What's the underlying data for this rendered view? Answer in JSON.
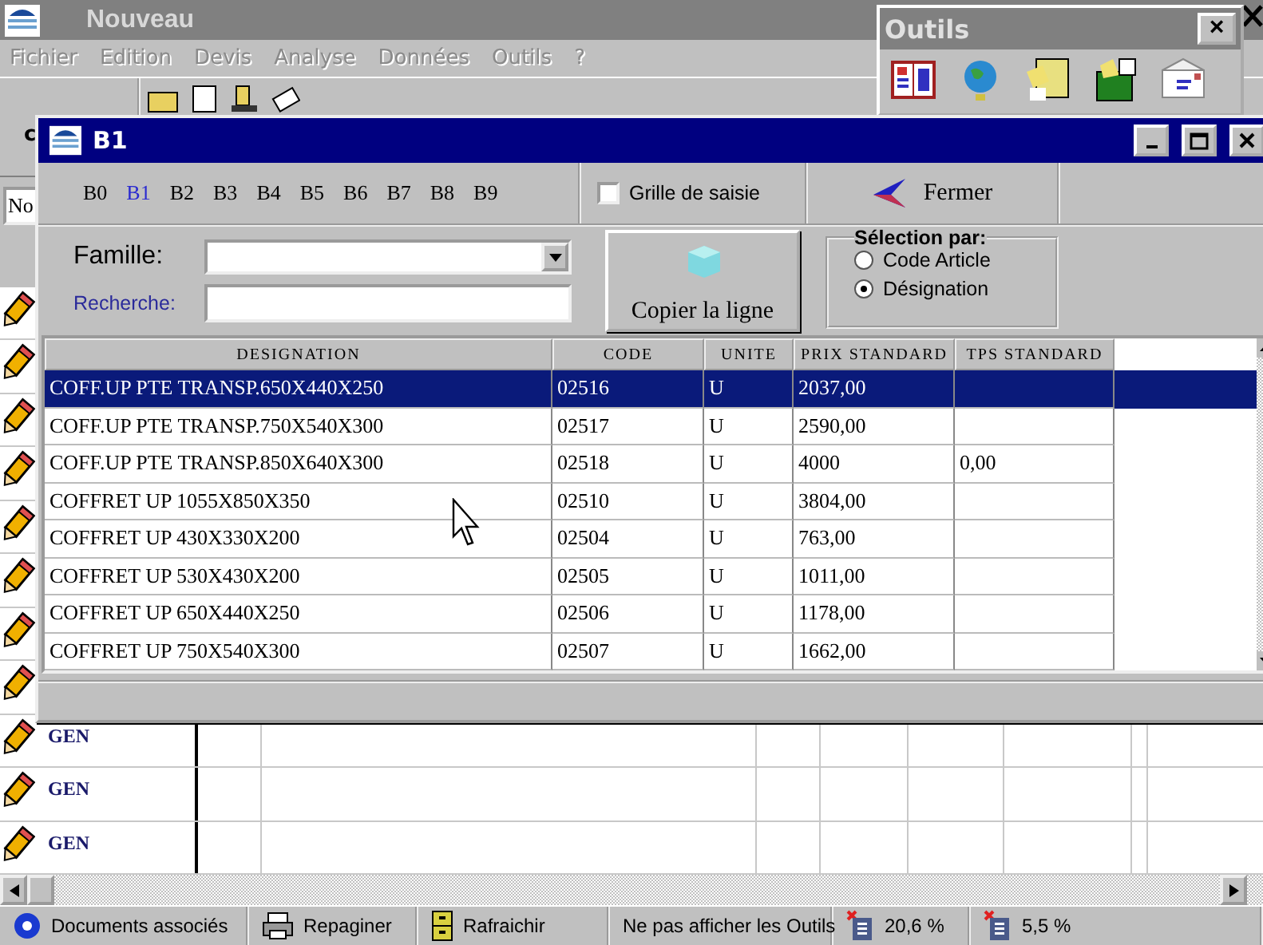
{
  "main_window": {
    "title": "Nouveau",
    "menu": [
      "Fichier",
      "Edition",
      "Devis",
      "Analyse",
      "Données",
      "Outils",
      "?"
    ],
    "toolbar_label": "c",
    "field_value": "No",
    "grid_rows": [
      {
        "kind": "blank"
      },
      {
        "kind": "blank"
      },
      {
        "kind": "blank"
      },
      {
        "kind": "blank"
      },
      {
        "kind": "blank"
      },
      {
        "kind": "blank"
      },
      {
        "kind": "blank"
      },
      {
        "kind": "blank"
      },
      {
        "kind": "label",
        "label": "GEN"
      },
      {
        "kind": "label",
        "label": "GEN"
      },
      {
        "kind": "label",
        "label": "GEN"
      }
    ]
  },
  "tools_palette": {
    "title": "Outils",
    "close": "×"
  },
  "dialog": {
    "title": "B1",
    "tabs": [
      {
        "label": "B0",
        "selected": false
      },
      {
        "label": "B1",
        "selected": true
      },
      {
        "label": "B2",
        "selected": false
      },
      {
        "label": "B3",
        "selected": false
      },
      {
        "label": "B4",
        "selected": false
      },
      {
        "label": "B5",
        "selected": false
      },
      {
        "label": "B6",
        "selected": false
      },
      {
        "label": "B7",
        "selected": false
      },
      {
        "label": "B8",
        "selected": false
      },
      {
        "label": "B9",
        "selected": false
      }
    ],
    "grid_checkbox": {
      "label": "Grille de saisie",
      "checked": false
    },
    "close_button": "Fermer",
    "famille_label": "Famille:",
    "recherche_label": "Recherche:",
    "copy_button": "Copier la ligne",
    "selection": {
      "title": "Sélection par:",
      "options": [
        {
          "label": "Code Article",
          "selected": false
        },
        {
          "label": "Désignation",
          "selected": true
        }
      ]
    },
    "table": {
      "columns": [
        "DESIGNATION",
        "CODE",
        "UNITE",
        "PRIX STANDARD",
        "TPS STANDARD"
      ],
      "rows": [
        {
          "cells": [
            "COFF.UP PTE TRANSP.650X440X250",
            "02516",
            "U",
            "2037,00",
            ""
          ],
          "selected": true
        },
        {
          "cells": [
            "COFF.UP PTE TRANSP.750X540X300",
            "02517",
            "U",
            "2590,00",
            ""
          ],
          "selected": false
        },
        {
          "cells": [
            "COFF.UP PTE TRANSP.850X640X300",
            "02518",
            "U",
            "4000",
            "0,00"
          ],
          "selected": false
        },
        {
          "cells": [
            "COFFRET UP 1055X850X350",
            "02510",
            "U",
            "3804,00",
            ""
          ],
          "selected": false
        },
        {
          "cells": [
            "COFFRET UP 430X330X200",
            "02504",
            "U",
            "763,00",
            ""
          ],
          "selected": false
        },
        {
          "cells": [
            "COFFRET UP 530X430X200",
            "02505",
            "U",
            "1011,00",
            ""
          ],
          "selected": false
        },
        {
          "cells": [
            "COFFRET UP 650X440X250",
            "02506",
            "U",
            "1178,00",
            ""
          ],
          "selected": false
        },
        {
          "cells": [
            "COFFRET UP 750X540X300",
            "02507",
            "U",
            "1662,00",
            ""
          ],
          "selected": false
        }
      ]
    }
  },
  "status_bar": [
    {
      "kind": "disc",
      "label": "Documents associés"
    },
    {
      "kind": "printer",
      "label": "Repaginer"
    },
    {
      "kind": "cabinet",
      "label": "Rafraichir"
    },
    {
      "kind": "text",
      "label": "Ne pas afficher les Outils"
    },
    {
      "kind": "gauge",
      "label": "20,6 %"
    },
    {
      "kind": "gauge",
      "label": "5,5 %"
    }
  ]
}
